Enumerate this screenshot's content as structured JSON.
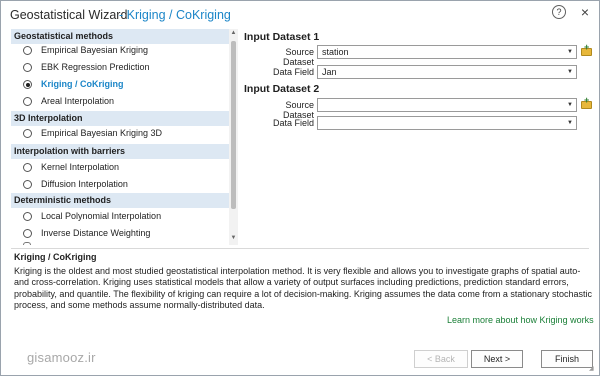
{
  "window": {
    "title": "Geostatistical Wizard",
    "subtitle": "- Kriging / CoKriging",
    "help_glyph": "?",
    "close_glyph": "×"
  },
  "methods": {
    "groups": [
      {
        "header": "Geostatistical methods"
      },
      {
        "header": "3D Interpolation"
      },
      {
        "header": "Interpolation with barriers"
      },
      {
        "header": "Deterministic methods"
      }
    ],
    "items": [
      {
        "label": "Empirical Bayesian Kriging",
        "selected": false
      },
      {
        "label": "EBK Regression Prediction",
        "selected": false
      },
      {
        "label": "Kriging / CoKriging",
        "selected": true
      },
      {
        "label": "Areal Interpolation",
        "selected": false
      },
      {
        "label": "Empirical Bayesian Kriging 3D",
        "selected": false
      },
      {
        "label": "Kernel Interpolation",
        "selected": false
      },
      {
        "label": "Diffusion Interpolation",
        "selected": false
      },
      {
        "label": "Local Polynomial Interpolation",
        "selected": false
      },
      {
        "label": "Inverse Distance Weighting",
        "selected": false
      }
    ]
  },
  "inputs": {
    "dataset1": {
      "title": "Input Dataset 1",
      "source_label": "Source Dataset",
      "source_value": "station",
      "field_label": "Data Field",
      "field_value": "Jan"
    },
    "dataset2": {
      "title": "Input Dataset 2",
      "source_label": "Source Dataset",
      "source_value": "",
      "field_label": "Data Field",
      "field_value": ""
    }
  },
  "description": {
    "title": "Kriging / CoKriging",
    "text": "Kriging is the oldest and most studied geostatistical interpolation method. It is very flexible and allows you to investigate graphs of spatial auto- and cross-correlation. Kriging uses statistical models that allow a variety of output surfaces including predictions, prediction standard errors, probability, and quantile. The flexibility of kriging can require a lot of decision-making. Kriging assumes the data come from a stationary stochastic process, and some methods assume normally-distributed data.",
    "link": "Learn more about how Kriging works"
  },
  "footer": {
    "watermark": "gisamooz.ir",
    "back_label": "< Back",
    "next_label": "Next >",
    "finish_label": "Finish"
  },
  "colors": {
    "accent": "#1c86c8",
    "group_header_bg": "#dde8f3",
    "link": "#1a7f37",
    "folder": "#e7b73a"
  }
}
